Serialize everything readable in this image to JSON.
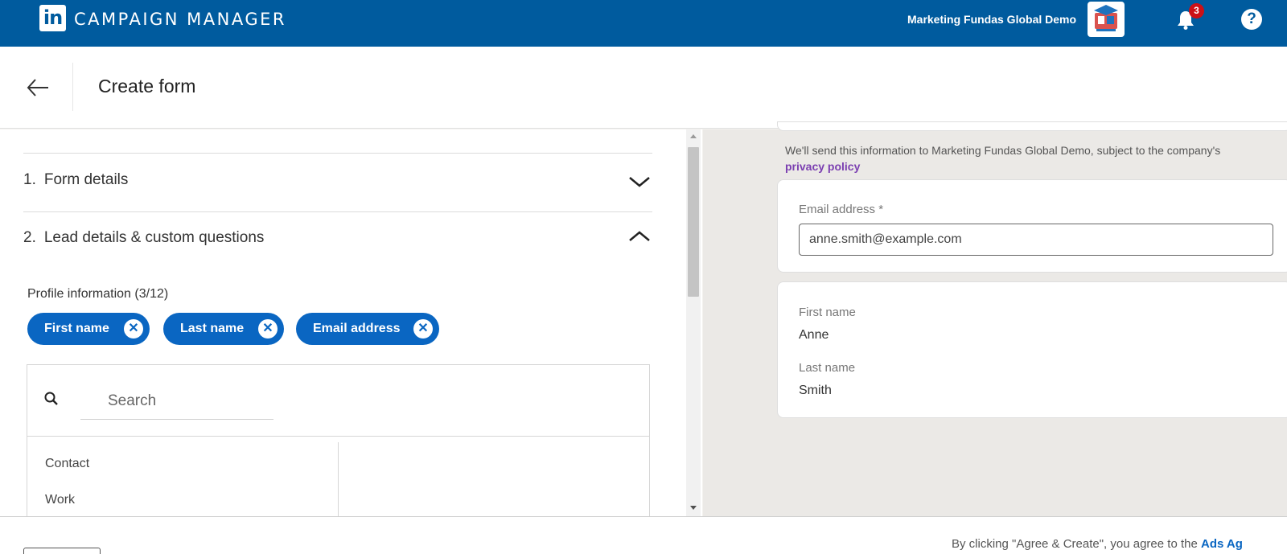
{
  "topbar": {
    "brand_logo_text": "in",
    "brand_title": "CAMPAIGN MANAGER",
    "account_name": "Marketing Fundas Global Demo",
    "notification_count": "3",
    "help_glyph": "?",
    "color": "#005b9e"
  },
  "header": {
    "title": "Create form"
  },
  "left": {
    "sections": [
      {
        "number": "1.",
        "title": "Form details",
        "state": "collapsed"
      },
      {
        "number": "2.",
        "title": "Lead details & custom questions",
        "state": "expanded"
      }
    ],
    "profile_label": "Profile information (3/12)",
    "chips": [
      {
        "label": "First name"
      },
      {
        "label": "Last name"
      },
      {
        "label": "Email address"
      }
    ],
    "chip_remove_glyph": "✕",
    "search": {
      "placeholder": "Search"
    },
    "categories": [
      {
        "label": "Contact"
      },
      {
        "label": "Work"
      }
    ]
  },
  "preview": {
    "consent_text": "We'll send this information to Marketing Fundas Global Demo, subject to the company's",
    "privacy_link": "privacy policy",
    "email_label": "Email address *",
    "email_value": "anne.smith@example.com",
    "fields": [
      {
        "label": "First name",
        "value": "Anne"
      },
      {
        "label": "Last name",
        "value": "Smith"
      }
    ]
  },
  "footer": {
    "agree_text": "By clicking \"Agree & Create\", you agree to the",
    "agree_link": "Ads Ag"
  },
  "icons": {
    "back": "back-arrow-icon",
    "bell": "bell-icon",
    "help": "help-icon",
    "search": "search-icon",
    "chevron_down": "chevron-down-icon",
    "chevron_up": "chevron-up-icon"
  },
  "colors": {
    "chip_blue": "#0a66c2",
    "link_purple": "#7b3fb1",
    "badge_red": "#cc1016"
  }
}
